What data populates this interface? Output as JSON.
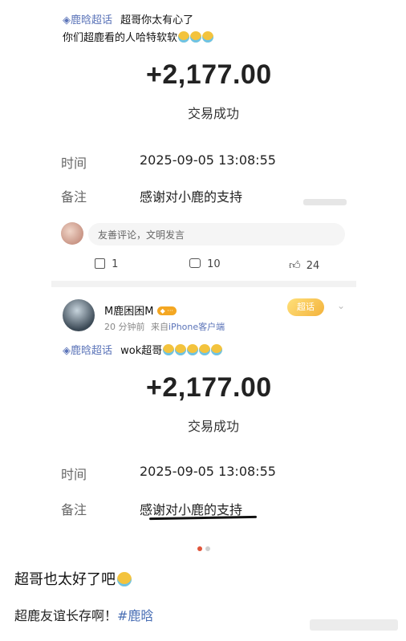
{
  "screenshot1": {
    "topic_tag": "鹿晗超话",
    "line1": "超哥你太有心了",
    "line2": "你们超鹿看的人哈特软软",
    "amount": "+2,177.00",
    "status": "交易成功",
    "time_label": "时间",
    "time_value": "2025-09-05 13:08:55",
    "note_label": "备注",
    "note_value": "感谢对小鹿的支持",
    "comment_placeholder": "友善评论，文明发言",
    "repost_count": "1",
    "comment_count": "10",
    "like_count": "24"
  },
  "screenshot2": {
    "username": "M鹿困困M",
    "time_ago": "20 分钟前",
    "source_prefix": "来自",
    "source": "iPhone客户端",
    "super_badge": "超话",
    "topic_tag": "鹿晗超话",
    "text": "wok超哥",
    "amount": "+2,177.00",
    "status": "交易成功",
    "time_label": "时间",
    "time_value": "2025-09-05 13:08:55",
    "note_label": "备注",
    "note_value": "感谢对小鹿的支持"
  },
  "post": {
    "headline": "超哥也太好了吧",
    "body": "超鹿友谊长存啊！",
    "hashtag": "#鹿晗"
  },
  "colors": {
    "topic": "#5a73b8",
    "hashtag": "#4a6fb5"
  }
}
